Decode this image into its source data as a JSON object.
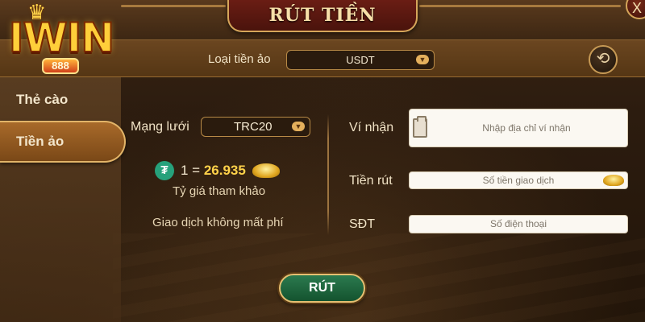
{
  "app": {
    "logo_text": "IWIN",
    "logo_sub": "888",
    "title": "RÚT TIỀN",
    "close_symbol": "X"
  },
  "header": {
    "coin_type_label": "Loại tiền ảo",
    "coin_type_value": "USDT",
    "history_icon": "history-icon"
  },
  "sidebar": {
    "items": [
      {
        "label": "Thẻ cào",
        "active": false
      },
      {
        "label": "Tiền ảo",
        "active": true
      }
    ]
  },
  "form": {
    "network_label": "Mạng lưới",
    "network_value": "TRC20",
    "rate_prefix": "1 =",
    "rate_value": "26.935",
    "rate_caption": "Tỷ giá tham khảo",
    "fee_note": "Giao dịch không mất phí",
    "wallet_label": "Ví nhận",
    "wallet_placeholder": "Nhập địa chỉ ví nhận",
    "amount_label": "Tiền rút",
    "amount_placeholder": "Số tiền giao dịch",
    "phone_label": "SĐT",
    "phone_placeholder": "Số điện thoại",
    "submit_label": "RÚT"
  },
  "colors": {
    "accent_gold": "#e6bf72",
    "submit_green": "#1f6b42",
    "tether_green": "#26a17b"
  }
}
